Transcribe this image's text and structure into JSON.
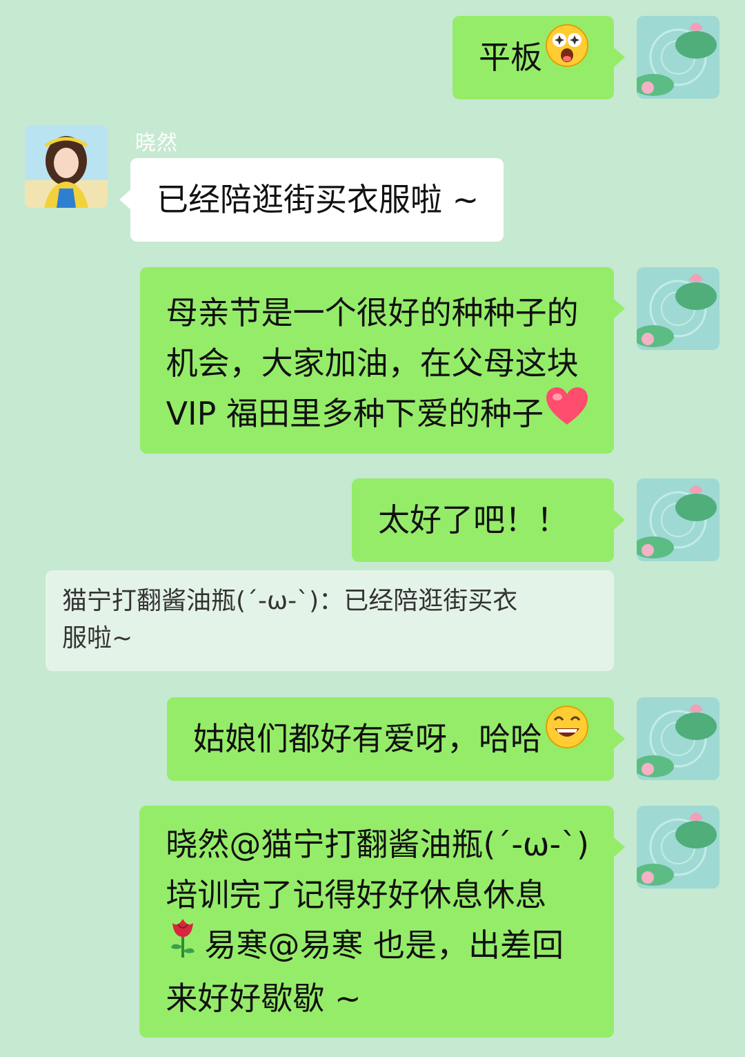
{
  "messages": [
    {
      "side": "out",
      "text": "平板",
      "emoji": "starstruck-emoji"
    },
    {
      "side": "in",
      "sender": "晓然",
      "text": "已经陪逛街买衣服啦 ~"
    },
    {
      "side": "out",
      "lines": [
        "母亲节是一个很好的种种子的",
        "机会，大家加油，在父母这块",
        "VIP 福田里多种下爱的种子"
      ],
      "emoji": "heart-emoji"
    },
    {
      "side": "out",
      "text": "太好了吧！！"
    },
    {
      "side": "quote",
      "lines": [
        "猫宁打翻酱油瓶(´-ω-`)：已经陪逛街买衣",
        "服啦~"
      ]
    },
    {
      "side": "out",
      "text": "姑娘们都好有爱呀，哈哈",
      "emoji": "grin-emoji"
    },
    {
      "side": "out",
      "lines": [
        "晓然@猫宁打翻酱油瓶(´-ω-`)",
        "培训完了记得好好休息休息",
        "易寒@易寒 也是，出差回",
        "来好好歇歇 ~"
      ],
      "emoji": "rose-emoji"
    }
  ],
  "colors": {
    "background": "#c6e9d1",
    "outgoing_bubble": "#95ec69",
    "incoming_bubble": "#ffffff",
    "quote_bubble": "#e4f3e8"
  }
}
